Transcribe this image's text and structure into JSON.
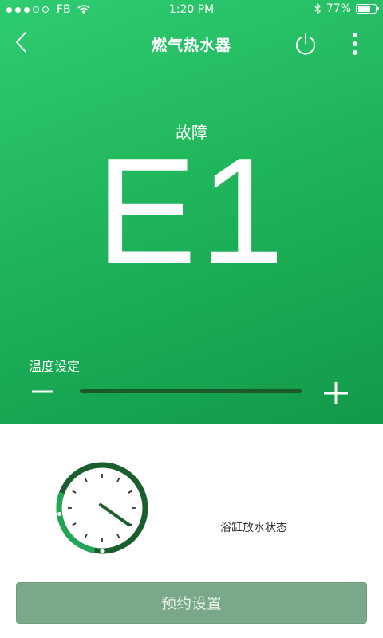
{
  "status_bar": {
    "carrier": "FB",
    "time": "1:20 PM",
    "battery": "77%",
    "battery_level": 0.77,
    "signal_strength": 3
  },
  "header": {
    "title": "燃气热水器",
    "back_icon": "back-chevron-icon",
    "power_icon": "power-icon",
    "more_icon": "more-vertical-icon"
  },
  "status": {
    "fault_label": "故障",
    "fault_code": "E1"
  },
  "temperature": {
    "label": "温度设定",
    "level": 1.0
  },
  "bath": {
    "label": "浴缸放水状态",
    "progress_fraction": 0.28
  },
  "actions": {
    "reserve_label": "预约设置"
  },
  "colors": {
    "primary_green": "#27c46a",
    "dark_green": "#1a5a2a",
    "button_green": "#7aa98a"
  }
}
